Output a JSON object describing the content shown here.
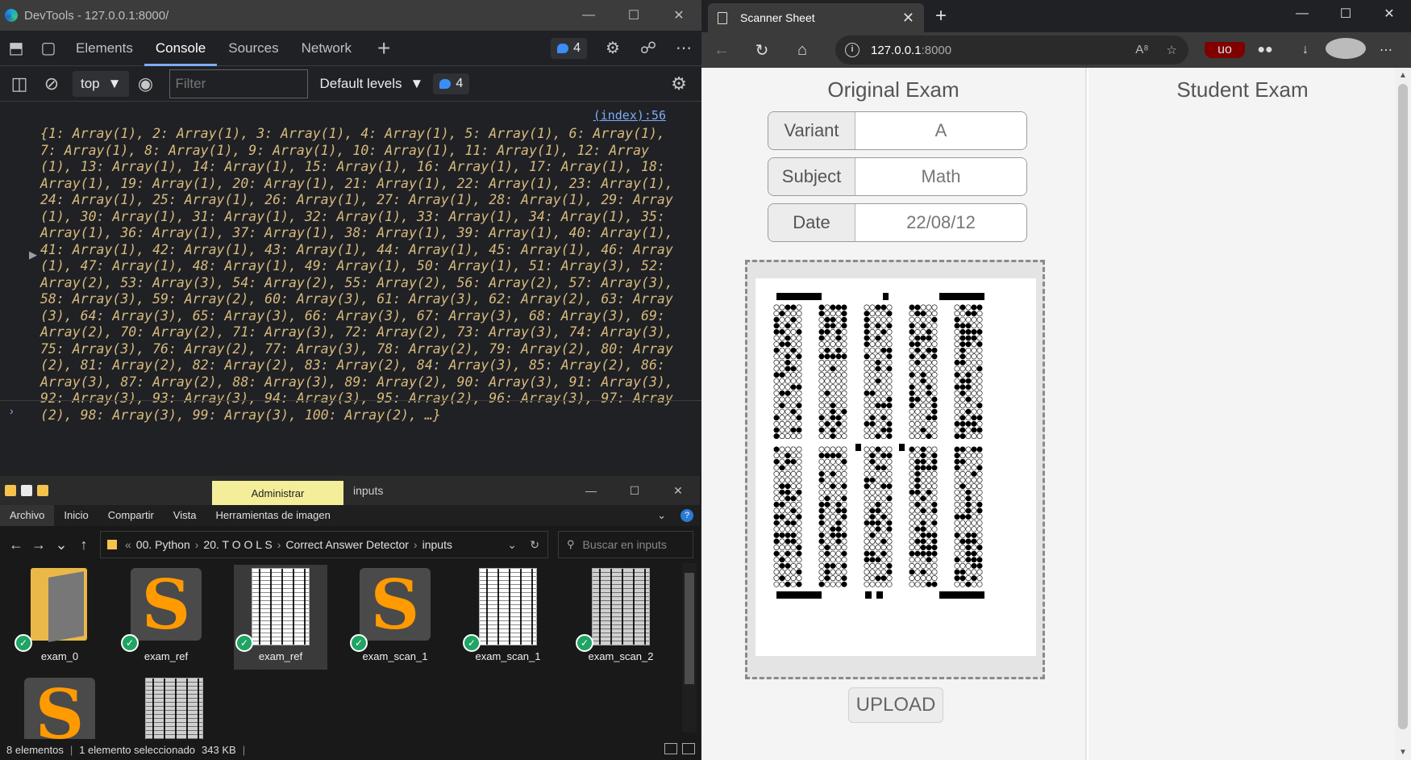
{
  "devtools": {
    "window_title": "DevTools - 127.0.0.1:8000/",
    "tabs": [
      "Elements",
      "Console",
      "Sources",
      "Network"
    ],
    "active_tab": "Console",
    "issues_count": "4",
    "toolbar": {
      "context": "top",
      "filter_placeholder": "Filter",
      "levels": "Default levels",
      "messages_count": "4"
    },
    "console": {
      "source_link": "(index):56",
      "log_text": "{1: Array(1), 2: Array(1), 3: Array(1), 4: Array(1), 5: Array(1), 6: Array(1), 7: Array(1), 8: Array(1), 9: Array(1), 10: Array(1), 11: Array(1), 12: Array(1), 13: Array(1), 14: Array(1), 15: Array(1), 16: Array(1), 17: Array(1), 18: Array(1), 19: Array(1), 20: Array(1), 21: Array(1), 22: Array(1), 23: Array(1), 24: Array(1), 25: Array(1), 26: Array(1), 27: Array(1), 28: Array(1), 29: Array(1), 30: Array(1), 31: Array(1), 32: Array(1), 33: Array(1), 34: Array(1), 35: Array(1), 36: Array(1), 37: Array(1), 38: Array(1), 39: Array(1), 40: Array(1), 41: Array(1), 42: Array(1), 43: Array(1), 44: Array(1), 45: Array(1), 46: Array(1), 47: Array(1), 48: Array(1), 49: Array(1), 50: Array(1), 51: Array(3), 52: Array(2), 53: Array(3), 54: Array(2), 55: Array(2), 56: Array(2), 57: Array(3), 58: Array(3), 59: Array(2), 60: Array(3), 61: Array(3), 62: Array(2), 63: Array(3), 64: Array(3), 65: Array(3), 66: Array(3), 67: Array(3), 68: Array(3), 69: Array(2), 70: Array(2), 71: Array(3), 72: Array(2), 73: Array(3), 74: Array(3), 75: Array(3), 76: Array(2), 77: Array(3), 78: Array(2), 79: Array(2), 80: Array(2), 81: Array(2), 82: Array(2), 83: Array(2), 84: Array(3), 85: Array(2), 86: Array(3), 87: Array(2), 88: Array(3), 89: Array(2), 90: Array(3), 91: Array(3), 92: Array(3), 93: Array(3), 94: Array(3), 95: Array(2), 96: Array(3), 97: Array(2), 98: Array(3), 99: Array(3), 100: Array(2), …}",
      "prompt": "›"
    }
  },
  "explorer": {
    "contextual_tab": "Administrar",
    "folder_name": "inputs",
    "ribbon": [
      "Archivo",
      "Inicio",
      "Compartir",
      "Vista",
      "Herramientas de imagen"
    ],
    "breadcrumb": [
      "00. Python",
      "20. T O O L S",
      "Correct Answer Detector",
      "inputs"
    ],
    "search_placeholder": "Buscar en inputs",
    "files": [
      {
        "name": "exam_0",
        "kind": "folder-icon"
      },
      {
        "name": "exam_ref",
        "kind": "sublime-icon"
      },
      {
        "name": "exam_ref",
        "kind": "image-icon"
      },
      {
        "name": "exam_scan_1",
        "kind": "sublime-icon"
      },
      {
        "name": "exam_scan_1",
        "kind": "image-icon"
      },
      {
        "name": "exam_scan_2",
        "kind": "image-icon"
      }
    ],
    "status": {
      "count": "8 elementos",
      "selection": "1 elemento seleccionado",
      "size": "343 KB"
    }
  },
  "browser": {
    "tab_title": "Scanner Sheet",
    "url_host": "127.0.0.1",
    "url_port": ":8000",
    "page": {
      "left_title": "Original Exam",
      "right_title": "Student Exam",
      "fields": [
        {
          "label": "Variant",
          "value": "A"
        },
        {
          "label": "Subject",
          "value": "Math"
        },
        {
          "label": "Date",
          "value": "22/08/12"
        }
      ],
      "upload_label": "UPLOAD"
    }
  },
  "colors": {
    "console_text": "#d7ba7d",
    "link": "#7cacf8",
    "checkmark": "#1fa463",
    "admin_tab": "#f4ee9b"
  }
}
